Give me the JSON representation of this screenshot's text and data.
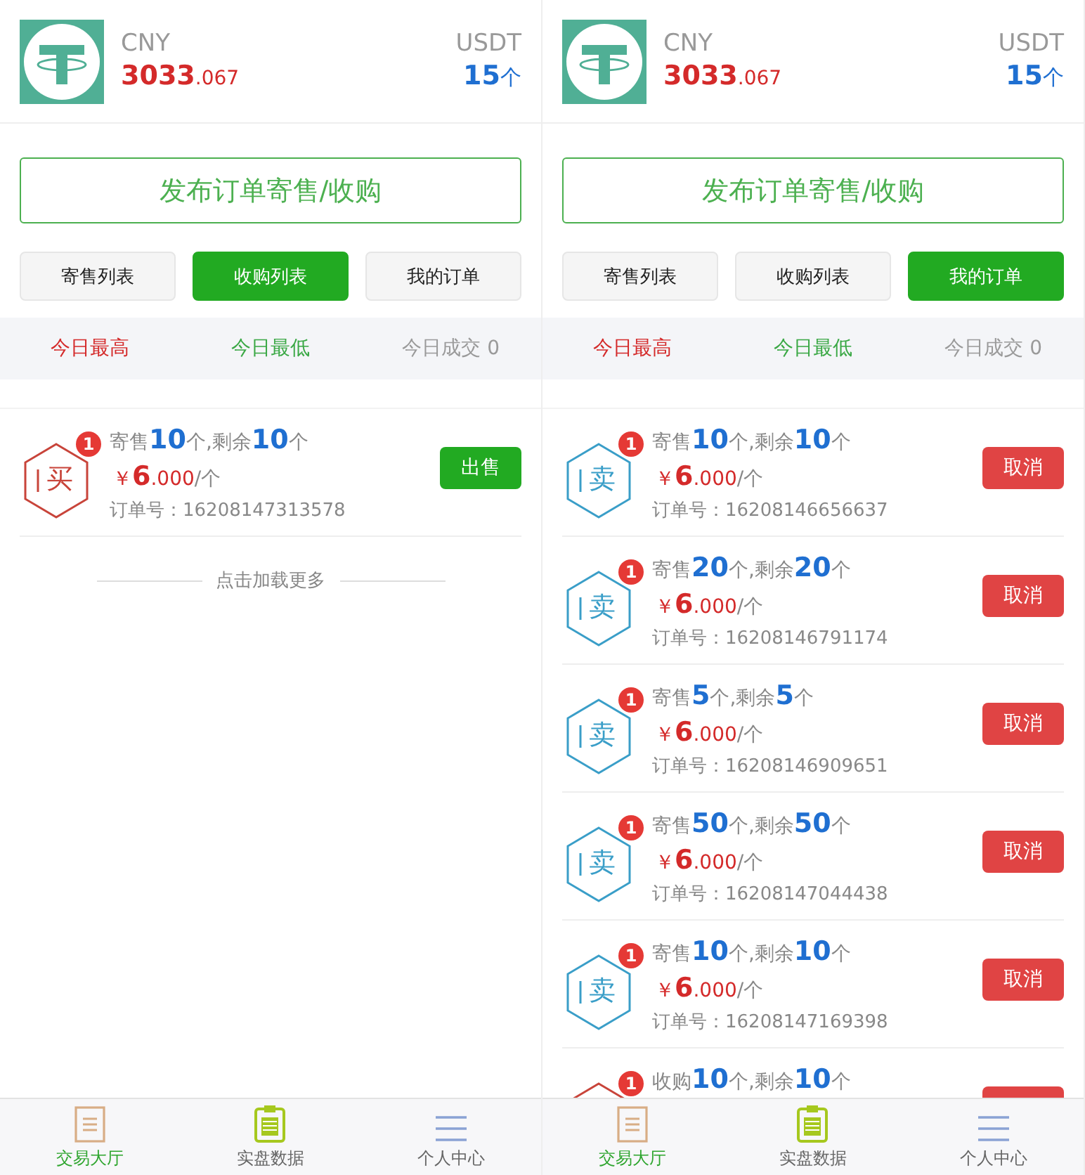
{
  "screens": [
    {
      "header": {
        "cny_label": "CNY",
        "cny_value": "**3033**.067",
        "usdt_label": "USDT",
        "usdt_value": "**15**个"
      },
      "publish_button": "发布订单寄售/收购",
      "tabs": [
        {
          "label": "寄售列表",
          "selected": false
        },
        {
          "label": "收购列表",
          "selected": true
        },
        {
          "label": "我的订单",
          "selected": false
        }
      ],
      "stats": [
        {
          "label": "今日最高",
          "color": "#d42a2a"
        },
        {
          "label": "今日最低",
          "color": "#3aa845"
        },
        {
          "label": "今日成交 0",
          "color": "#9a9a9a"
        }
      ],
      "orders": [
        {
          "kind": "buy",
          "tag": "买",
          "badge": "1",
          "quantity": "寄售**10**个,剩余**10**个",
          "price": "￥**6**.000",
          "per": "/个",
          "order_no": "订单号：16208147313578",
          "button": {
            "kind": "sell",
            "label": "出售"
          }
        }
      ],
      "load_more": "点击加载更多",
      "nav": [
        {
          "label": "交易大厅",
          "kind": "document",
          "selected": true
        },
        {
          "label": "实盘数据",
          "kind": "clipboard",
          "selected": false
        },
        {
          "label": "个人中心",
          "kind": "menu",
          "selected": false
        }
      ]
    },
    {
      "header": {
        "cny_label": "CNY",
        "cny_value": "**3033**.067",
        "usdt_label": "USDT",
        "usdt_value": "**15**个"
      },
      "publish_button": "发布订单寄售/收购",
      "tabs": [
        {
          "label": "寄售列表",
          "selected": false
        },
        {
          "label": "收购列表",
          "selected": false
        },
        {
          "label": "我的订单",
          "selected": true
        }
      ],
      "stats": [
        {
          "label": "今日最高",
          "color": "#d42a2a"
        },
        {
          "label": "今日最低",
          "color": "#3aa845"
        },
        {
          "label": "今日成交 0",
          "color": "#9a9a9a"
        }
      ],
      "orders": [
        {
          "kind": "sell",
          "tag": "卖",
          "badge": "1",
          "quantity": "寄售**10**个,剩余**10**个",
          "price": "￥**6**.000",
          "per": "/个",
          "order_no": "订单号：16208146656637",
          "button": {
            "kind": "cancel",
            "label": "取消"
          }
        },
        {
          "kind": "sell",
          "tag": "卖",
          "badge": "1",
          "quantity": "寄售**20**个,剩余**20**个",
          "price": "￥**6**.000",
          "per": "/个",
          "order_no": "订单号：16208146791174",
          "button": {
            "kind": "cancel",
            "label": "取消"
          }
        },
        {
          "kind": "sell",
          "tag": "卖",
          "badge": "1",
          "quantity": "寄售**5**个,剩余**5**个",
          "price": "￥**6**.000",
          "per": "/个",
          "order_no": "订单号：16208146909651",
          "button": {
            "kind": "cancel",
            "label": "取消"
          }
        },
        {
          "kind": "sell",
          "tag": "卖",
          "badge": "1",
          "quantity": "寄售**50**个,剩余**50**个",
          "price": "￥**6**.000",
          "per": "/个",
          "order_no": "订单号：16208147044438",
          "button": {
            "kind": "cancel",
            "label": "取消"
          }
        },
        {
          "kind": "sell",
          "tag": "卖",
          "badge": "1",
          "quantity": "寄售**10**个,剩余**10**个",
          "price": "￥**6**.000",
          "per": "/个",
          "order_no": "订单号：16208147169398",
          "button": {
            "kind": "cancel",
            "label": "取消"
          }
        },
        {
          "kind": "buy",
          "badge": "1",
          "quantity": "收购**10**个,剩余**10**个",
          "button": {
            "kind": "cancel"
          }
        }
      ],
      "nav": [
        {
          "label": "交易大厅",
          "kind": "document",
          "selected": true
        },
        {
          "label": "实盘数据",
          "kind": "clipboard",
          "selected": false
        },
        {
          "label": "个人中心",
          "kind": "menu",
          "selected": false
        }
      ]
    }
  ]
}
